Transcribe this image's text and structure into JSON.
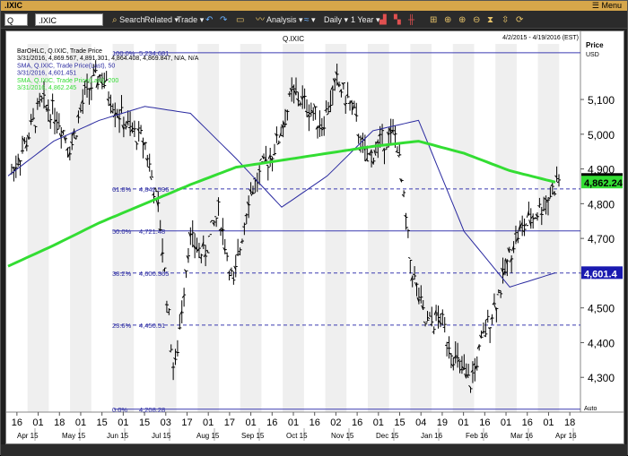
{
  "window": {
    "title": ".IXIC",
    "menu_label": "Menu"
  },
  "toolbar": {
    "q_field": "Q",
    "symbol_value": ".IXIC",
    "search_label": "Search",
    "related_label": "Related",
    "trade_label": "Trade",
    "analysis_label": "Analysis",
    "frequency_label": "Daily",
    "range_label": "1 Year"
  },
  "chart_header": {
    "symbol_title": "Q.IXIC",
    "date_range": "4/2/2015 - 4/19/2016 (EST)",
    "price_label": "Price",
    "currency_label": "USD",
    "legend": [
      "BarOHLC, Q.IXIC, Trade Price",
      "3/31/2016, 4,869.567, 4,891.301, 4,864.408, 4,869.847, N/A, N/A",
      "SMA, Q.IXIC, Trade Price(Last), 50",
      "3/31/2016, 4,601.451",
      "SMA, Q.IXIC, Trade Price(Last), 200",
      "3/31/2016, 4,862.245"
    ],
    "legend_colors": [
      "#000000",
      "#000000",
      "#2a2aa0",
      "#2a2aa0",
      "#33dd33",
      "#33dd33"
    ],
    "auto_label": "Auto"
  },
  "chart_data": {
    "type": "bar",
    "ylim": [
      4200,
      5260
    ],
    "yticks": [
      4300,
      4400,
      4500,
      4600,
      4700,
      4800,
      4900,
      5000,
      5100
    ],
    "ytick_labels": [
      "4,300",
      "4,400",
      "4,500",
      "4,600",
      "4,700",
      "4,800",
      "4,900",
      "5,000",
      "5,100"
    ],
    "fib_levels": [
      {
        "pct": "100.0%",
        "value": 5234.681,
        "label": "5,234.681",
        "color": "#3b3bb0",
        "dashed": false
      },
      {
        "pct": "61.8%",
        "value": 4842.596,
        "label": "4,842.596",
        "color": "#3b3bb0",
        "dashed": true
      },
      {
        "pct": "50.0%",
        "value": 4721.48,
        "label": "4,721.48",
        "color": "#3b3bb0",
        "dashed": false
      },
      {
        "pct": "38.2%",
        "value": 4600.365,
        "label": "4,600.365",
        "color": "#3b3bb0",
        "dashed": true
      },
      {
        "pct": "23.6%",
        "value": 4450.51,
        "label": "4,450.51",
        "color": "#3b3bb0",
        "dashed": true
      },
      {
        "pct": "0.0%",
        "value": 4208.28,
        "label": "4,208.28",
        "color": "#3b3bb0",
        "dashed": false
      }
    ],
    "price_tags": [
      {
        "label": "4,869.8",
        "value": 4869.847,
        "bg": "#000000",
        "fg": "#ffffff"
      },
      {
        "label": "4,862.24",
        "value": 4862.245,
        "bg": "#33dd33",
        "fg": "#000000"
      },
      {
        "label": "4,601.4",
        "value": 4601.451,
        "bg": "#1a1ab0",
        "fg": "#ffffff"
      }
    ],
    "x_day_labels": [
      "16",
      "01",
      "18",
      "01",
      "15",
      "01",
      "15",
      "03",
      "17",
      "01",
      "17",
      "01",
      "16",
      "01",
      "16",
      "02",
      "16",
      "01",
      "15",
      "04",
      "19",
      "01",
      "16",
      "01",
      "16",
      "01",
      "18"
    ],
    "x_month_labels": [
      "Apr 15",
      "May 15",
      "Jun 15",
      "Jul 15",
      "Aug 15",
      "Sep 15",
      "Oct 15",
      "Nov 15",
      "Dec 15",
      "Jan 16",
      "Feb 16",
      "Mar 16",
      "Apr 16"
    ],
    "bar_color": "#000000",
    "sma50_color": "#2a2aa0",
    "sma200_color": "#33dd33",
    "sma200_points": [
      [
        "Apr 15",
        4620
      ],
      [
        "May 15",
        4680
      ],
      [
        "Jun 15",
        4745
      ],
      [
        "Jul 15",
        4800
      ],
      [
        "Aug 15",
        4855
      ],
      [
        "Sep 15",
        4905
      ],
      [
        "Oct 15",
        4925
      ],
      [
        "Nov 15",
        4945
      ],
      [
        "Dec 15",
        4965
      ],
      [
        "Jan 16",
        4980
      ],
      [
        "Feb 16",
        4945
      ],
      [
        "Mar 16",
        4895
      ],
      [
        "Apr 16",
        4862
      ]
    ],
    "sma50_points": [
      [
        "Apr 15",
        4880
      ],
      [
        "May 15",
        4980
      ],
      [
        "Jun 15",
        5040
      ],
      [
        "Jul 15",
        5080
      ],
      [
        "Aug 15",
        5060
      ],
      [
        "Sep 15",
        4930
      ],
      [
        "Oct 15",
        4790
      ],
      [
        "Nov 15",
        4880
      ],
      [
        "Dec 15",
        5010
      ],
      [
        "Jan 16",
        5040
      ],
      [
        "Feb 16",
        4720
      ],
      [
        "Mar 16",
        4560
      ],
      [
        "Apr 16",
        4601
      ]
    ]
  },
  "bottom_bar": {
    "status": ""
  }
}
